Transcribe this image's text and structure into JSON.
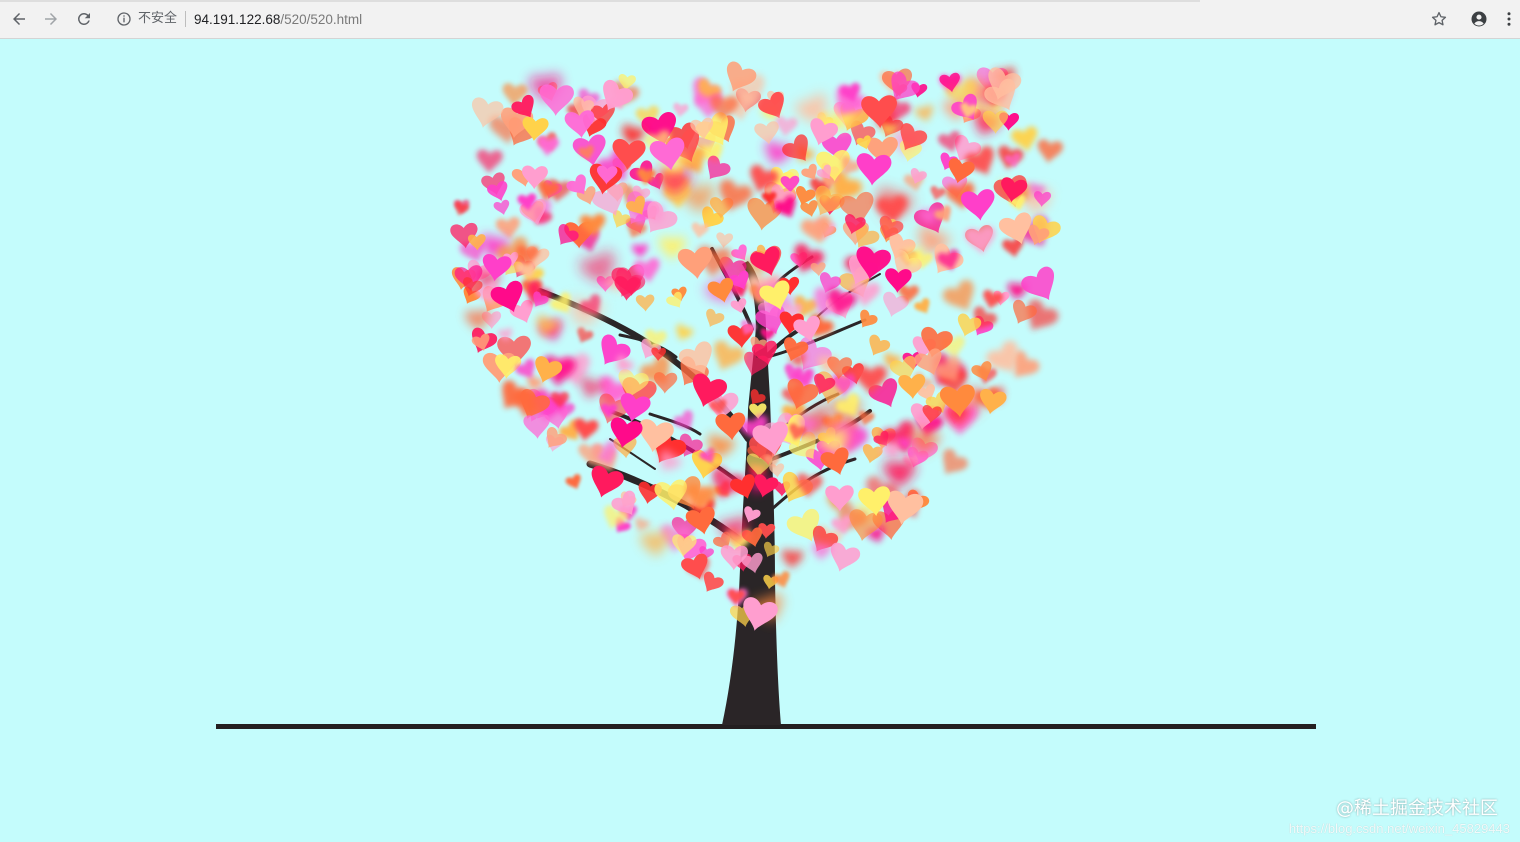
{
  "browser": {
    "security_label": "不安全",
    "url_host": "94.191.122.68",
    "url_path": "/520/520.html",
    "icons": {
      "back": "arrow-left-icon",
      "forward": "arrow-right-icon",
      "reload": "reload-icon",
      "info": "info-icon",
      "bookmark": "star-icon",
      "account": "account-icon",
      "menu": "kebab-menu-icon"
    }
  },
  "page": {
    "background": "#c4fcfc",
    "trunk_color": "#2a2527",
    "heart_colors": [
      "#ff1a5e",
      "#ff4d4d",
      "#ff6a3d",
      "#ff8a3d",
      "#ffb14a",
      "#ffd24a",
      "#fff06a",
      "#ff6ad5",
      "#ff3fc9",
      "#ff9ecf",
      "#ffa07a",
      "#ff2f2f",
      "#ff0a8a",
      "#ffc0a0"
    ]
  },
  "watermark": {
    "text": "@稀土掘金技术社区",
    "url": "https://blog.csdn.net/weixin_45829443"
  }
}
